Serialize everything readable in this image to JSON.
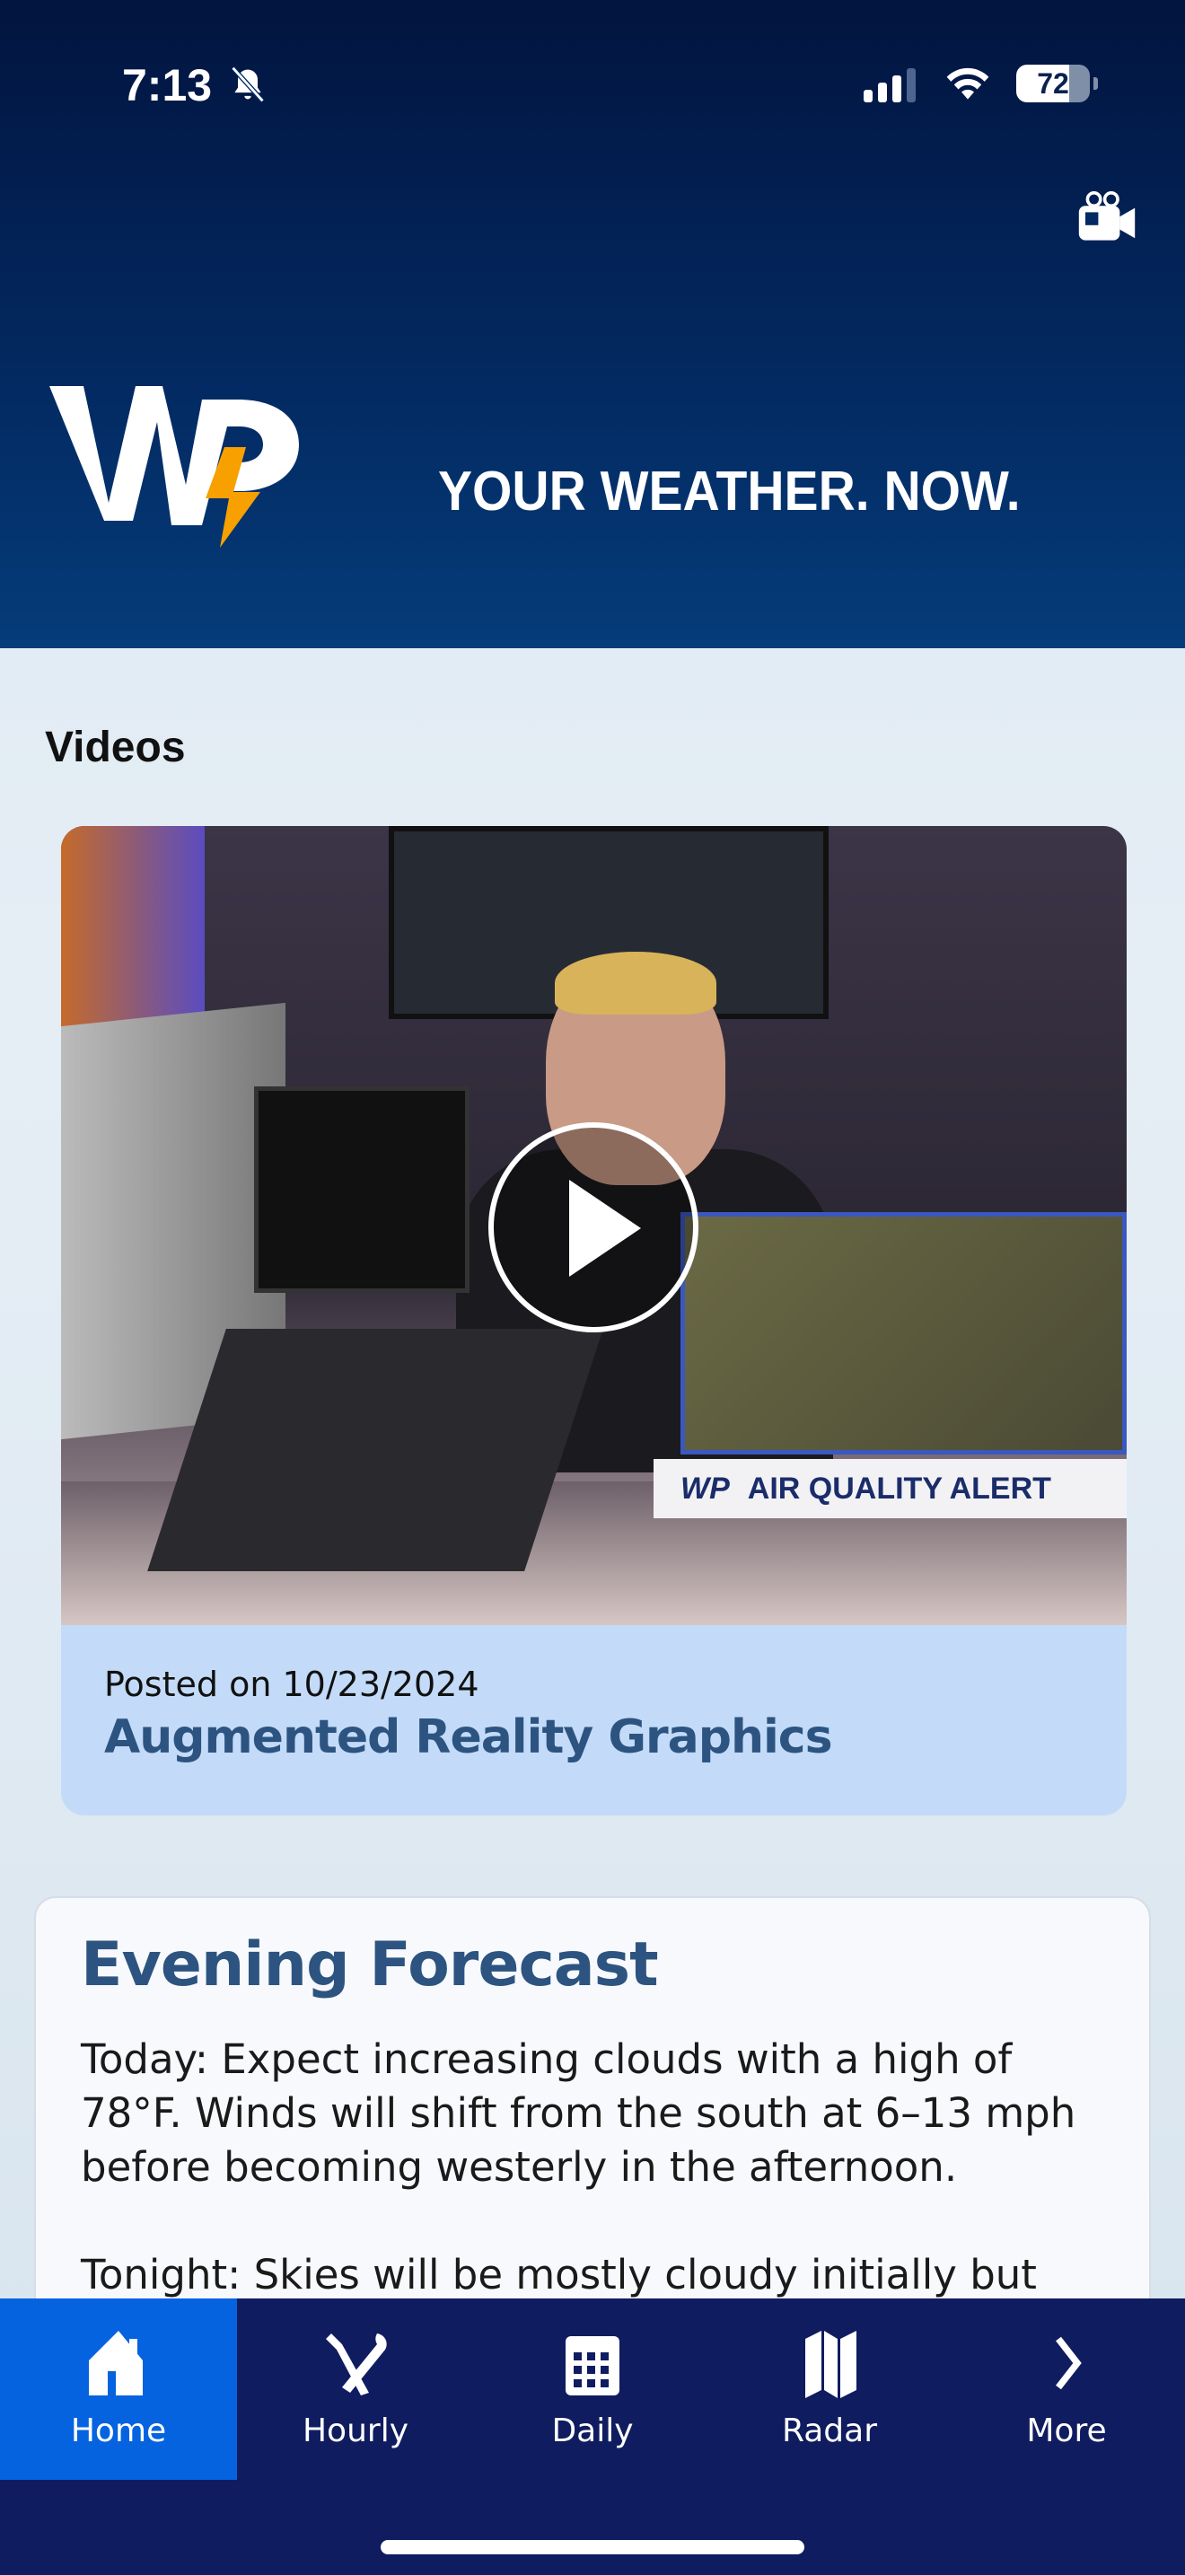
{
  "status_bar": {
    "time": "7:13",
    "battery": "72",
    "icons": [
      "bell-slash-icon",
      "cellular-signal-icon",
      "wifi-icon",
      "battery-icon"
    ]
  },
  "header": {
    "tagline": "YOUR WEATHER. NOW.",
    "logo_text": "WP",
    "action_icon": "video-camera-icon",
    "colors": {
      "background": "#032a62",
      "logo_bolt": "#f7a000"
    }
  },
  "videos": {
    "section_title": "Videos",
    "items": [
      {
        "posted": "Posted on 10/23/2024",
        "title": "Augmented Reality Graphics",
        "thumbnail_overlay": {
          "logo": "WP",
          "banner": "AIR QUALITY ALERT"
        }
      }
    ]
  },
  "forecast": {
    "title": "Evening Forecast",
    "paragraphs": [
      "Today: Expect increasing clouds with a high of 78°F. Winds will shift from the south at 6–13 mph before becoming westerly in the afternoon.",
      "Tonight: Skies will be mostly cloudy initially but"
    ]
  },
  "tabbar": {
    "active": "Home",
    "accent": "#0563e0",
    "background": "#101c60",
    "items": [
      {
        "label": "Home",
        "icon": "home-icon"
      },
      {
        "label": "Hourly",
        "icon": "tools-icon"
      },
      {
        "label": "Daily",
        "icon": "calendar-icon"
      },
      {
        "label": "Radar",
        "icon": "map-icon"
      },
      {
        "label": "More",
        "icon": "chevron-right-icon"
      }
    ]
  }
}
